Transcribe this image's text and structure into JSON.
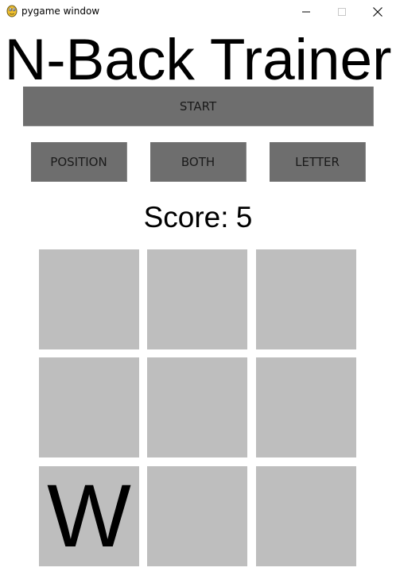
{
  "window": {
    "title": "pygame window",
    "icon": "pygame-snake-icon",
    "controls": [
      "minimize-icon",
      "maximize-icon",
      "close-icon"
    ]
  },
  "app": {
    "title": "N-Back Trainer",
    "buttons": {
      "start": "START",
      "position": "POSITION",
      "both": "BOTH",
      "letter": "LETTER"
    },
    "score_label": "Score:",
    "score_value": "5",
    "grid": [
      "",
      "",
      "",
      "",
      "",
      "",
      "W",
      "",
      ""
    ]
  },
  "colors": {
    "button_bg": "#6e6e6e",
    "cell_bg": "#bebebe",
    "background": "#ffffff",
    "text": "#000000"
  }
}
